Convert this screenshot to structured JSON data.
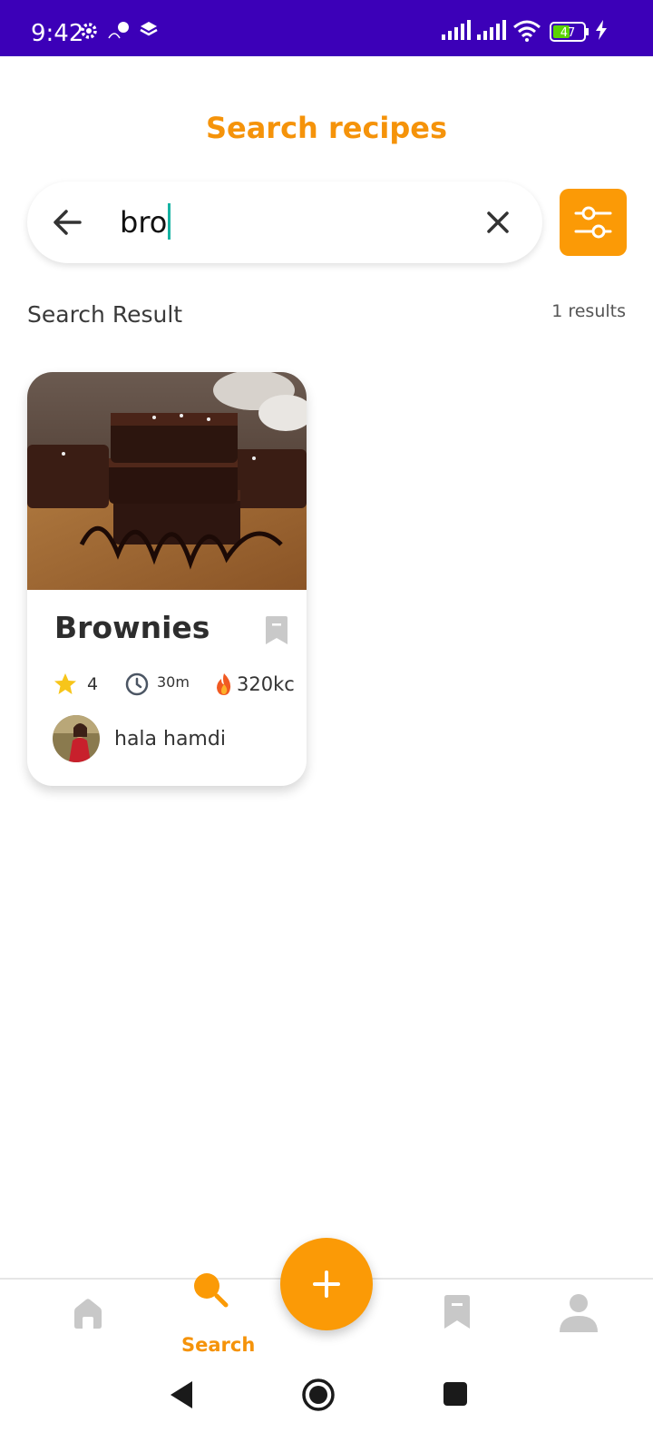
{
  "status_bar": {
    "time": "9:42",
    "battery": "47"
  },
  "header": {
    "title": "Search recipes"
  },
  "search": {
    "query": "bro"
  },
  "results": {
    "section_title": "Search Result",
    "count_text": "1 results"
  },
  "recipes": [
    {
      "name": "Brownies",
      "rating": "4",
      "time": "30m",
      "calories": "320kc",
      "author": "hala hamdi"
    }
  ],
  "bottom_nav": {
    "search_label": "Search",
    "active": "search"
  },
  "colors": {
    "accent": "#fb9a06",
    "status_bar": "#3c00b8",
    "caret": "#17b3a3",
    "inactive_icon": "#c8c8c8"
  }
}
